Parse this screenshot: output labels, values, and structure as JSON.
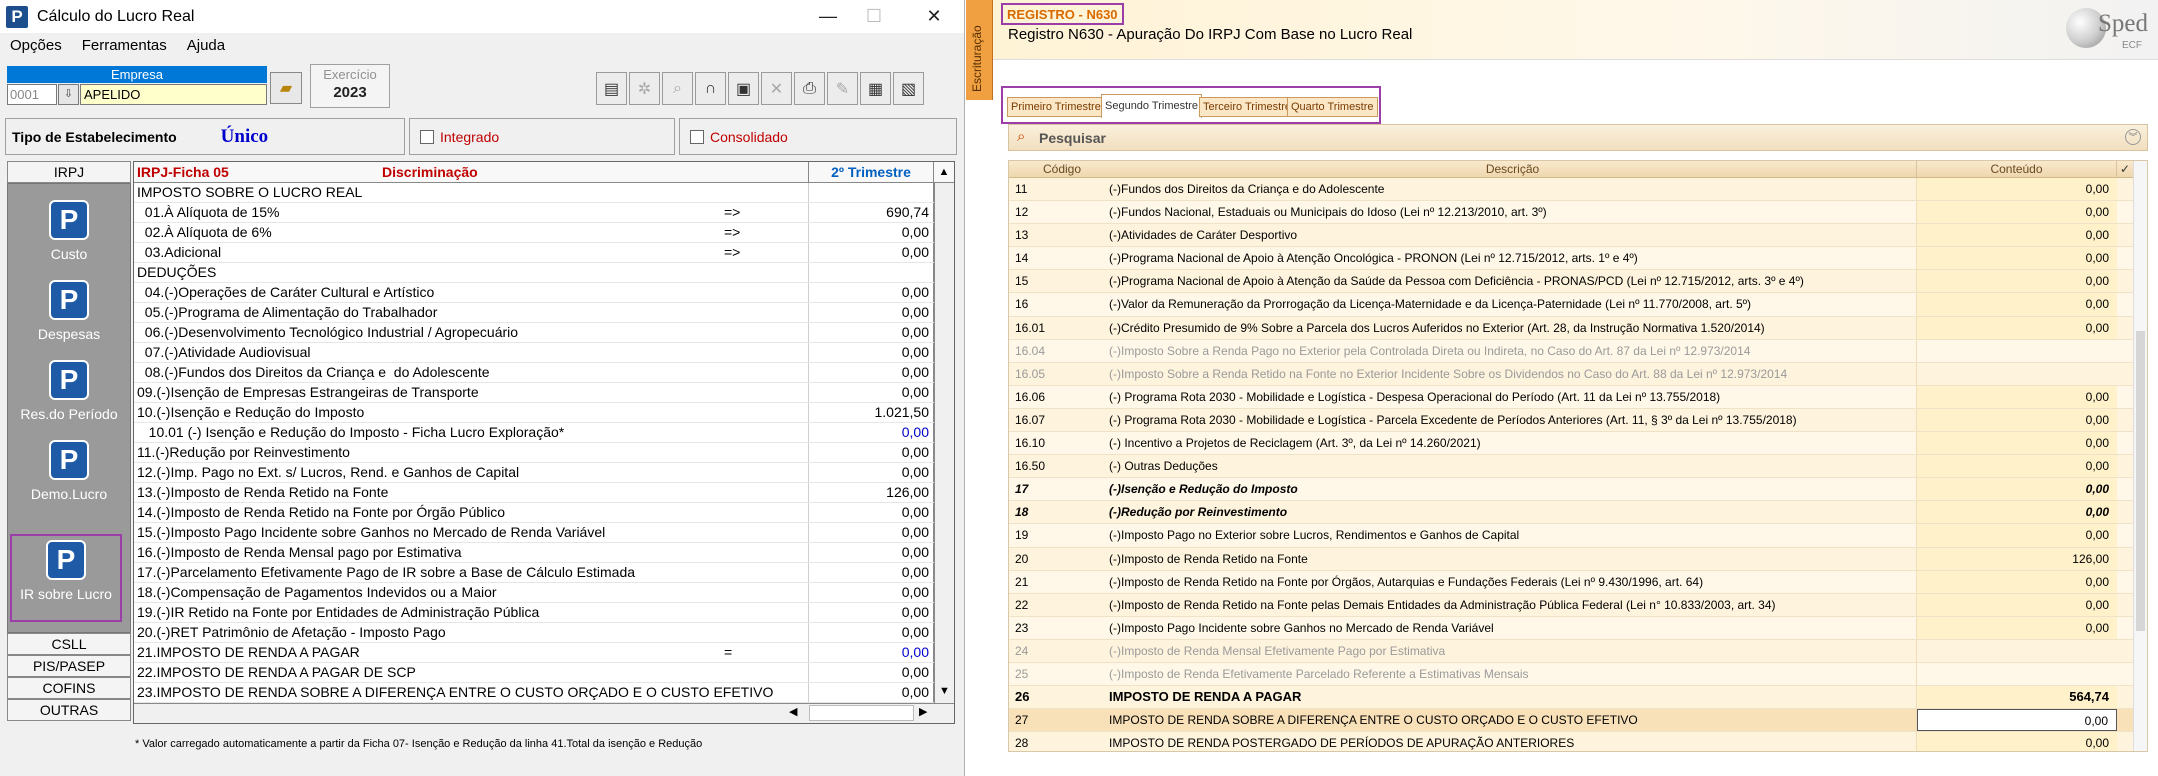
{
  "left": {
    "window_title": "Cálculo do Lucro Real",
    "menu": [
      "Opções",
      "Ferramentas",
      "Ajuda"
    ],
    "empresa": {
      "label": "Empresa",
      "code": "0001",
      "name": "APELIDO"
    },
    "exercicio": {
      "label": "Exercício",
      "value": "2023"
    },
    "tipo": {
      "label": "Tipo de Estabelecimento",
      "value": "Único",
      "integrado": "Integrado",
      "consolidado": "Consolidado"
    },
    "side_tabs_top": [
      "IRPJ"
    ],
    "side_items": [
      "Custo",
      "Despesas",
      "Res.do Período",
      "Demo.Lucro",
      "IR sobre Lucro"
    ],
    "side_tabs_bottom": [
      "CSLL",
      "PIS/PASEP",
      "COFINS",
      "OUTRAS"
    ],
    "grid": {
      "ficha": "IRPJ-Ficha 05",
      "desc_header": "Discriminação",
      "value_header": "2º Trimestre",
      "rows": [
        {
          "d": "IMPOSTO SOBRE O LUCRO REAL",
          "a": "",
          "v": ""
        },
        {
          "d": "  01.À Alíquota de 15%",
          "a": "=>",
          "v": "690,74"
        },
        {
          "d": "  02.À Alíquota de 6%",
          "a": "=>",
          "v": "0,00"
        },
        {
          "d": "  03.Adicional",
          "a": "=>",
          "v": "0,00"
        },
        {
          "d": "DEDUÇÕES",
          "a": "",
          "v": ""
        },
        {
          "d": "  04.(-)Operações de Caráter Cultural e Artístico",
          "a": "",
          "v": "0,00"
        },
        {
          "d": "  05.(-)Programa de Alimentação do Trabalhador",
          "a": "",
          "v": "0,00"
        },
        {
          "d": "  06.(-)Desenvolvimento Tecnológico Industrial / Agropecuário",
          "a": "",
          "v": "0,00"
        },
        {
          "d": "  07.(-)Atividade Audiovisual",
          "a": "",
          "v": "0,00"
        },
        {
          "d": "  08.(-)Fundos dos Direitos da Criança e  do Adolescente",
          "a": "",
          "v": "0,00"
        },
        {
          "d": "09.(-)Isenção de Empresas Estrangeiras de Transporte",
          "a": "",
          "v": "0,00"
        },
        {
          "d": "10.(-)Isenção e Redução do Imposto",
          "a": "",
          "v": "1.021,50"
        },
        {
          "d": "   10.01 (-) Isenção e Redução do Imposto - Ficha Lucro Exploração*",
          "a": "",
          "v": "0,00",
          "blue": true
        },
        {
          "d": "11.(-)Redução por Reinvestimento",
          "a": "",
          "v": "0,00"
        },
        {
          "d": "12.(-)Imp. Pago no Ext. s/ Lucros, Rend. e Ganhos de Capital",
          "a": "",
          "v": "0,00"
        },
        {
          "d": "13.(-)Imposto de Renda Retido na Fonte",
          "a": "",
          "v": "126,00"
        },
        {
          "d": "14.(-)Imposto de Renda Retido na Fonte por Órgão Público",
          "a": "",
          "v": "0,00"
        },
        {
          "d": "15.(-)Imposto Pago Incidente sobre Ganhos no Mercado de Renda Variável",
          "a": "",
          "v": "0,00"
        },
        {
          "d": "16.(-)Imposto de Renda Mensal pago por Estimativa",
          "a": "",
          "v": "0,00"
        },
        {
          "d": "17.(-)Parcelamento Efetivamente Pago de IR sobre a Base de Cálculo Estimada",
          "a": "",
          "v": "0,00"
        },
        {
          "d": "18.(-)Compensação de Pagamentos Indevidos ou a Maior",
          "a": "",
          "v": "0,00"
        },
        {
          "d": "19.(-)IR Retido na Fonte por Entidades de Administração Pública",
          "a": "",
          "v": "0,00"
        },
        {
          "d": "20.(-)RET Patrimônio de Afetação - Imposto Pago",
          "a": "",
          "v": "0,00"
        },
        {
          "d": "21.IMPOSTO DE RENDA A PAGAR",
          "a": "=",
          "v": "0,00",
          "blue": true
        },
        {
          "d": "22.IMPOSTO DE RENDA A PAGAR DE SCP",
          "a": "",
          "v": "0,00"
        },
        {
          "d": "23.IMPOSTO DE RENDA SOBRE A DIFERENÇA ENTRE O CUSTO ORÇADO E O CUSTO EFETIVO",
          "a": "",
          "v": "0,00"
        }
      ]
    },
    "footnote": "* Valor carregado automaticamente a partir da Ficha 07- Isenção e Redução da linha 41.Total da isenção e Redução"
  },
  "right": {
    "side_tab": "Escrituração",
    "reg_code": "REGISTRO - N630",
    "reg_title": "Registro N630 - Apuração Do IRPJ Com Base no Lucro Real",
    "logo_word": "Sped",
    "logo_sub": "ECF",
    "tabs": [
      "Primeiro Trimestre",
      "Segundo Trimestre",
      "Terceiro Trimestre",
      "Quarto Trimestre"
    ],
    "search": "Pesquisar",
    "headers": {
      "code": "Código",
      "desc": "Descrição",
      "cont": "Conteúdo"
    },
    "rows": [
      {
        "c": "11",
        "d": "(-)Fundos dos Direitos da Criança e do Adolescente",
        "v": "0,00"
      },
      {
        "c": "12",
        "d": "(-)Fundos Nacional, Estaduais ou Municipais do Idoso (Lei nº 12.213/2010, art. 3º)",
        "v": "0,00"
      },
      {
        "c": "13",
        "d": "(-)Atividades de Caráter Desportivo",
        "v": "0,00"
      },
      {
        "c": "14",
        "d": "(-)Programa Nacional de Apoio à Atenção Oncológica - PRONON (Lei nº 12.715/2012, arts. 1º e 4º)",
        "v": "0,00"
      },
      {
        "c": "15",
        "d": "(-)Programa Nacional de Apoio à Atenção da Saúde da Pessoa com Deficiência - PRONAS/PCD (Lei nº 12.715/2012, arts. 3º e 4º)",
        "v": "0,00"
      },
      {
        "c": "16",
        "d": "(-)Valor da Remuneração da Prorrogação da Licença-Maternidade e da Licença-Paternidade (Lei nº 11.770/2008, art. 5º)",
        "v": "0,00"
      },
      {
        "c": "16.01",
        "d": "(-)Crédito Presumido de 9% Sobre a Parcela dos Lucros Auferidos no Exterior (Art. 28, da Instrução Normativa 1.520/2014)",
        "v": "0,00"
      },
      {
        "c": "16.04",
        "d": "(-)Imposto Sobre a Renda Pago no Exterior pela Controlada Direta ou Indireta, no Caso do Art. 87 da Lei nº 12.973/2014",
        "v": "",
        "gray": true
      },
      {
        "c": "16.05",
        "d": "(-)Imposto Sobre a Renda Retido na Fonte no Exterior Incidente Sobre os Dividendos no Caso do Art. 88 da Lei nº 12.973/2014",
        "v": "",
        "gray": true
      },
      {
        "c": "16.06",
        "d": "(-) Programa Rota 2030 - Mobilidade e Logística - Despesa Operacional do Período (Art. 11 da Lei nº 13.755/2018)",
        "v": "0,00"
      },
      {
        "c": "16.07",
        "d": "(-) Programa Rota 2030 - Mobilidade e Logística - Parcela Excedente de Períodos Anteriores (Art. 11, § 3º da Lei nº 13.755/2018)",
        "v": "0,00"
      },
      {
        "c": "16.10",
        "d": "(-) Incentivo a Projetos de Reciclagem (Art. 3º, da Lei nº 14.260/2021)",
        "v": "0,00"
      },
      {
        "c": "16.50",
        "d": "(-) Outras Deduções",
        "v": "0,00"
      },
      {
        "c": "17",
        "d": "(-)Isenção e Redução do Imposto",
        "v": "0,00",
        "bi": true
      },
      {
        "c": "18",
        "d": "(-)Redução por Reinvestimento",
        "v": "0,00",
        "bi": true
      },
      {
        "c": "19",
        "d": "(-)Imposto Pago no Exterior sobre Lucros, Rendimentos e Ganhos de Capital",
        "v": "0,00"
      },
      {
        "c": "20",
        "d": "(-)Imposto de Renda Retido na Fonte",
        "v": "126,00"
      },
      {
        "c": "21",
        "d": "(-)Imposto de Renda Retido na Fonte por Órgãos, Autarquias e Fundações Federais (Lei nº 9.430/1996, art. 64)",
        "v": "0,00"
      },
      {
        "c": "22",
        "d": "(-)Imposto de Renda Retido na Fonte pelas Demais Entidades da Administração Pública Federal (Lei n° 10.833/2003, art. 34)",
        "v": "0,00"
      },
      {
        "c": "23",
        "d": "(-)Imposto Pago Incidente sobre Ganhos no Mercado de Renda Variável",
        "v": "0,00"
      },
      {
        "c": "24",
        "d": "(-)Imposto de Renda Mensal Efetivamente Pago por Estimativa",
        "v": "",
        "gray": true
      },
      {
        "c": "25",
        "d": "(-)Imposto de Renda Efetivamente Parcelado Referente a Estimativas Mensais",
        "v": "",
        "gray": true
      },
      {
        "c": "26",
        "d": "IMPOSTO DE RENDA A PAGAR",
        "v": "564,74",
        "bold": true
      },
      {
        "c": "27",
        "d": "IMPOSTO DE RENDA SOBRE A DIFERENÇA ENTRE O CUSTO ORÇADO E O CUSTO EFETIVO",
        "v": "0,00",
        "sel": true
      },
      {
        "c": "28",
        "d": "IMPOSTO DE RENDA POSTERGADO DE PERÍODOS DE APURAÇÃO ANTERIORES",
        "v": "0,00"
      }
    ]
  }
}
